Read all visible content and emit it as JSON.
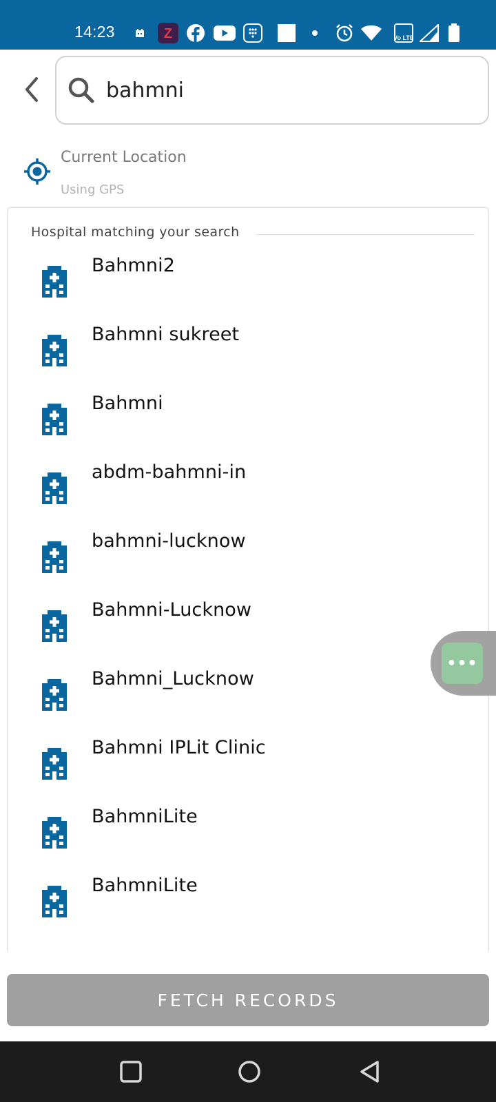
{
  "status_bar": {
    "time": "14:23",
    "icons": [
      "calendar-icon",
      "zomato-icon",
      "facebook-icon",
      "youtube-icon",
      "dialpad-icon",
      "square-icon",
      "dot-icon",
      "alarm-icon",
      "wifi-icon",
      "volte-icon",
      "signal-icon",
      "battery-icon"
    ],
    "zomato_letter": "Z",
    "volte_text": "Vo LTE"
  },
  "header": {
    "back_icon": "chevron-left-icon",
    "search": {
      "value": "bahmni",
      "icon": "search-icon"
    }
  },
  "location": {
    "icon": "gps-target-icon",
    "title": "Current Location",
    "subtitle": "Using GPS"
  },
  "results": {
    "heading": "Hospital matching your search",
    "item_icon": "hospital-building-icon",
    "items": [
      "Bahmni2",
      "Bahmni sukreet",
      "Bahmni",
      "abdm-bahmni-in",
      "bahmni-lucknow",
      "Bahmni-Lucknow",
      "Bahmni_Lucknow",
      "Bahmni IPLit Clinic",
      "BahmniLite",
      "BahmniLite"
    ]
  },
  "floating_button": {
    "label": "•••"
  },
  "fetch_button": {
    "label": "FETCH RECORDS"
  },
  "nav_bar": {
    "icons": [
      "recents-square-icon",
      "home-circle-icon",
      "back-triangle-icon"
    ]
  },
  "colors": {
    "status_bar": "#0a669e",
    "accent_blue": "#0a669e",
    "fetch_disabled": "#a0a0a0",
    "float_green": "#8fc79b",
    "nav_bar": "#1c1c1c"
  }
}
